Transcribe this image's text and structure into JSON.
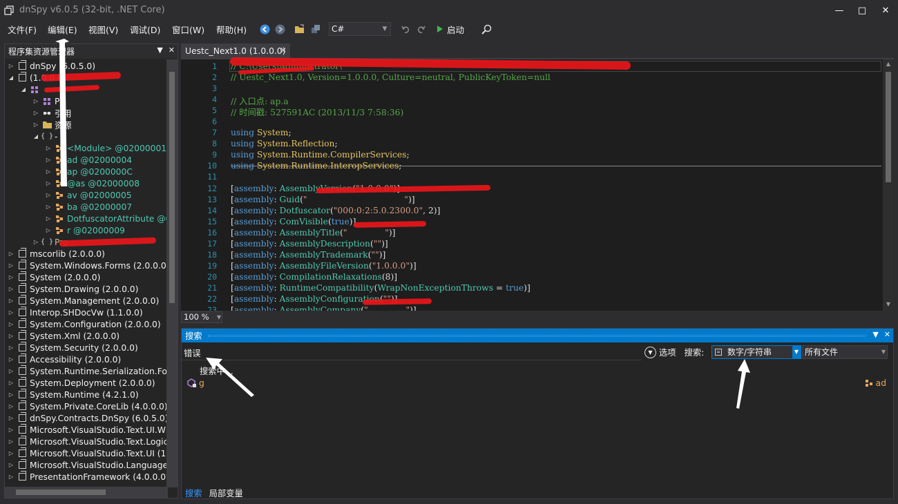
{
  "window": {
    "title": "dnSpy v6.0.5 (32-bit, .NET Core)",
    "minimize": "—",
    "maximize": "□",
    "close": "✕"
  },
  "menu": {
    "items": [
      "文件(F)",
      "编辑(E)",
      "视图(V)",
      "调试(D)",
      "窗口(W)",
      "帮助(H)"
    ],
    "language": "C#",
    "start_label": "启动"
  },
  "explorer": {
    "title": "程序集资源管理器",
    "tree": [
      {
        "label": "dnSpy (6.0.5.0)",
        "indent": 0,
        "expander": "▷",
        "icon": "assembly-icon"
      },
      {
        "label": "(1.0.0.0)",
        "indent": 0,
        "expander": "◢",
        "icon": "assembly-icon"
      },
      {
        "label": "",
        "indent": 1,
        "expander": "◢",
        "icon": "module-icon"
      },
      {
        "label": "PE",
        "indent": 2,
        "expander": "▷",
        "icon": "pe-icon"
      },
      {
        "label": "引用",
        "indent": 2,
        "expander": "▷",
        "icon": "references-icon"
      },
      {
        "label": "资源",
        "indent": 2,
        "expander": "▷",
        "icon": "folder-icon"
      },
      {
        "label": "-",
        "indent": 2,
        "expander": "◢",
        "icon": "namespace-icon"
      },
      {
        "label": "<Module> @02000001",
        "indent": 3,
        "expander": "▷",
        "icon": "class-icon",
        "color": "#4ec9b0"
      },
      {
        "label": "ad @02000004",
        "indent": 3,
        "expander": "▷",
        "icon": "class-icon",
        "color": "#4ec9b0"
      },
      {
        "label": "ap @0200000C",
        "indent": 3,
        "expander": "▷",
        "icon": "class-icon",
        "color": "#4ec9b0"
      },
      {
        "label": "@as @02000008",
        "indent": 3,
        "expander": "▷",
        "icon": "class-icon",
        "color": "#4ec9b0"
      },
      {
        "label": "av @02000005",
        "indent": 3,
        "expander": "▷",
        "icon": "class-icon",
        "color": "#4ec9b0"
      },
      {
        "label": "ba @02000007",
        "indent": 3,
        "expander": "▷",
        "icon": "class-icon",
        "color": "#4ec9b0"
      },
      {
        "label": "DotfuscatorAttribute @0",
        "indent": 3,
        "expander": "▷",
        "icon": "class-icon",
        "color": "#4ec9b0"
      },
      {
        "label": "r @02000009",
        "indent": 3,
        "expander": "▷",
        "icon": "class-icon",
        "color": "#4ec9b0"
      },
      {
        "label": "Pro",
        "indent": 2,
        "expander": "▷",
        "icon": "namespace-icon",
        "color": "#d7ba7d"
      },
      {
        "label": "mscorlib (2.0.0.0)",
        "indent": 0,
        "expander": "▷",
        "icon": "assembly-icon"
      },
      {
        "label": "System.Windows.Forms (2.0.0.0)",
        "indent": 0,
        "expander": "▷",
        "icon": "assembly-icon"
      },
      {
        "label": "System (2.0.0.0)",
        "indent": 0,
        "expander": "▷",
        "icon": "assembly-icon"
      },
      {
        "label": "System.Drawing (2.0.0.0)",
        "indent": 0,
        "expander": "▷",
        "icon": "assembly-icon"
      },
      {
        "label": "System.Management (2.0.0.0)",
        "indent": 0,
        "expander": "▷",
        "icon": "assembly-icon"
      },
      {
        "label": "Interop.SHDocVw (1.1.0.0)",
        "indent": 0,
        "expander": "▷",
        "icon": "assembly-icon"
      },
      {
        "label": "System.Configuration (2.0.0.0)",
        "indent": 0,
        "expander": "▷",
        "icon": "assembly-icon"
      },
      {
        "label": "System.Xml (2.0.0.0)",
        "indent": 0,
        "expander": "▷",
        "icon": "assembly-icon"
      },
      {
        "label": "System.Security (2.0.0.0)",
        "indent": 0,
        "expander": "▷",
        "icon": "assembly-icon"
      },
      {
        "label": "Accessibility (2.0.0.0)",
        "indent": 0,
        "expander": "▷",
        "icon": "assembly-icon"
      },
      {
        "label": "System.Runtime.Serialization.Form",
        "indent": 0,
        "expander": "▷",
        "icon": "assembly-icon"
      },
      {
        "label": "System.Deployment (2.0.0.0)",
        "indent": 0,
        "expander": "▷",
        "icon": "assembly-icon"
      },
      {
        "label": "System.Runtime (4.2.1.0)",
        "indent": 0,
        "expander": "▷",
        "icon": "assembly-icon"
      },
      {
        "label": "System.Private.CoreLib (4.0.0.0)",
        "indent": 0,
        "expander": "▷",
        "icon": "assembly-icon"
      },
      {
        "label": "dnSpy.Contracts.DnSpy (6.0.5.0)",
        "indent": 0,
        "expander": "▷",
        "icon": "assembly-icon"
      },
      {
        "label": "Microsoft.VisualStudio.Text.UI.Wp",
        "indent": 0,
        "expander": "▷",
        "icon": "assembly-icon"
      },
      {
        "label": "Microsoft.VisualStudio.Text.Logic",
        "indent": 0,
        "expander": "▷",
        "icon": "assembly-icon"
      },
      {
        "label": "Microsoft.VisualStudio.Text.UI (15",
        "indent": 0,
        "expander": "▷",
        "icon": "assembly-icon"
      },
      {
        "label": "Microsoft.VisualStudio.Language.",
        "indent": 0,
        "expander": "▷",
        "icon": "assembly-icon"
      },
      {
        "label": "PresentationFramework (4.0.0.0)",
        "indent": 0,
        "expander": "▷",
        "icon": "assembly-icon"
      }
    ]
  },
  "document": {
    "tab_label": "Uestc_Next1.0 (1.0.0.0)",
    "zoom": "100 %",
    "lines": [
      {
        "n": "1",
        "html": "<span class='c-comment'>// C:\\Users\\Administrator\\</span>"
      },
      {
        "n": "2",
        "html": "<span class='c-comment'>// Uestc_Next1.0, Version=1.0.0.0, Culture=neutral, PublicKeyToken=null</span>"
      },
      {
        "n": "3",
        "html": ""
      },
      {
        "n": "4",
        "html": "<span class='c-comment'>// 入口点: ap.a</span>"
      },
      {
        "n": "5",
        "html": "<span class='c-comment'>// 时间戳: 527591AC (2013/11/3 7:58:36)</span>"
      },
      {
        "n": "6",
        "html": ""
      },
      {
        "n": "7",
        "html": "<span class='c-bool'>using</span> <span class='c-ns'>System</span>;"
      },
      {
        "n": "8",
        "html": "<span class='c-bool'>using</span> <span class='c-ns'>System.Reflection</span>;"
      },
      {
        "n": "9",
        "html": "<span class='c-bool'>using</span> <span class='c-ns'>System.Runtime.CompilerServices</span>;"
      },
      {
        "n": "10",
        "html": "<span class='c-bool'>using</span> <span class='c-ns'>System.Runtime.InteropServices</span>;"
      },
      {
        "n": "11",
        "html": ""
      },
      {
        "n": "12",
        "html": "[<span class='c-bool'>assembly</span>: <span class='c-attr'>AssemblyVersion</span>(<span class='c-str'>\"1.0.0.0\"</span>)]"
      },
      {
        "n": "13",
        "html": "[<span class='c-bool'>assembly</span>: <span class='c-attr'>Guid</span>(<span class='c-str'>\"</span>                                    <span class='c-str'>\"</span>)]"
      },
      {
        "n": "14",
        "html": "[<span class='c-bool'>assembly</span>: <span class='c-attr'>Dotfuscator</span>(<span class='c-str'>\"000:0:2:5.0.2300.0\"</span>, 2)]"
      },
      {
        "n": "15",
        "html": "[<span class='c-bool'>assembly</span>: <span class='c-attr'>ComVisible</span>(<span class='c-bool'>true</span>)]"
      },
      {
        "n": "16",
        "html": "[<span class='c-bool'>assembly</span>: <span class='c-attr'>AssemblyTitle</span>(<span class='c-str'>\"</span>              <span class='c-str'>\"</span>)]"
      },
      {
        "n": "17",
        "html": "[<span class='c-bool'>assembly</span>: <span class='c-attr'>AssemblyDescription</span>(<span class='c-str'>\"\"</span>)]"
      },
      {
        "n": "18",
        "html": "[<span class='c-bool'>assembly</span>: <span class='c-attr'>AssemblyTrademark</span>(<span class='c-str'>\"\"</span>)]"
      },
      {
        "n": "19",
        "html": "[<span class='c-bool'>assembly</span>: <span class='c-attr'>AssemblyFileVersion</span>(<span class='c-str'>\"1.0.0.0\"</span>)]"
      },
      {
        "n": "20",
        "html": "[<span class='c-bool'>assembly</span>: <span class='c-attr'>CompilationRelaxations</span>(8)]"
      },
      {
        "n": "21",
        "html": "[<span class='c-bool'>assembly</span>: <span class='c-attr'>RuntimeCompatibility</span>(<span class='c-attr'>WrapNonExceptionThrows</span> = <span class='c-bool'>true</span>)]"
      },
      {
        "n": "22",
        "html": "[<span class='c-bool'>assembly</span>: <span class='c-attr'>AssemblyConfiguration</span>(<span class='c-str'>\"\"</span>)]"
      },
      {
        "n": "23",
        "html": "[<span class='c-bool'>assembly</span>: <span class='c-attr'>AssemblyCompany</span>(<span class='c-str'>\"</span>              <span class='c-str'>\"</span>)]"
      }
    ]
  },
  "search": {
    "title": "搜索",
    "input_value": "错误",
    "options_label": "选项",
    "search_label": "搜索:",
    "type_value": "数字/字符串",
    "scope_value": "所有文件",
    "status": "搜索中...",
    "result_name": "g",
    "result_location": "ad",
    "tabs": [
      "搜索",
      "局部变量"
    ]
  }
}
